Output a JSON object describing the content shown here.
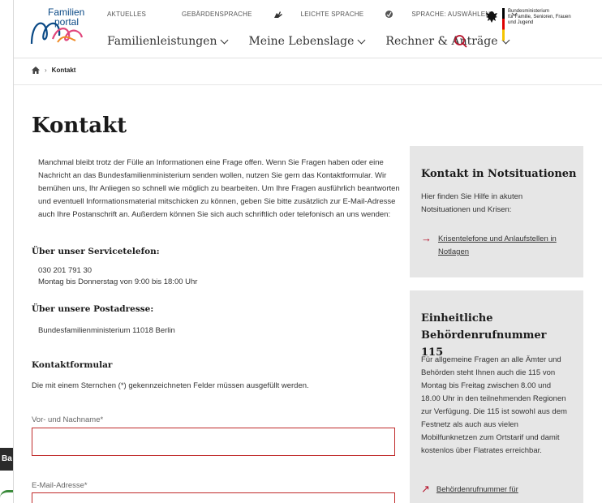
{
  "header": {
    "logo_line1": "Familien",
    "logo_line2": "portal",
    "topnav": [
      {
        "label": "AKTUELLES"
      },
      {
        "label": "GEBÄRDENSPRACHE"
      },
      {
        "label": "LEICHTE SPRACHE"
      },
      {
        "label": "SPRACHE: AUSWÄHLEN"
      }
    ],
    "mainnav": [
      {
        "label": "Familienleistungen"
      },
      {
        "label": "Meine Lebenslage"
      },
      {
        "label": "Rechner & Anträge"
      }
    ],
    "ministry": [
      "Bundesministerium",
      "für Familie, Senioren, Frauen",
      "und Jugend"
    ]
  },
  "breadcrumb": {
    "current": "Kontakt"
  },
  "page": {
    "title": "Kontakt",
    "intro": "Manchmal bleibt trotz der Fülle an Informationen eine Frage offen. Wenn Sie Fragen haben oder eine Nachricht an das Bundesfamilienministerium senden wollen, nutzen Sie gern das Kontaktformular. Wir bemühen uns, Ihr Anliegen so schnell wie möglich zu bearbeiten. Um Ihre Fragen ausführlich beantworten und eventuell Informationsmaterial mitschicken zu können, geben Sie bitte zusätzlich zur E-Mail-Adresse auch Ihre Postanschrift an. Außerdem können Sie sich auch schriftlich oder telefonisch an uns wenden:",
    "phone_heading": "Über unser Servicetelefon:",
    "phone_number": "030 201 791 30",
    "phone_hours": "Montag bis Donnerstag von 9:00 bis 18:00 Uhr",
    "post_heading": "Über unsere Postadresse:",
    "post_address": "Bundesfamilienministerium 11018 Berlin",
    "form_heading": "Kontaktformular",
    "form_note": "Die mit einem Sternchen (*) gekennzeichneten Felder müssen ausgefüllt werden.",
    "name_label": "Vor- und Nachname*",
    "email_label": "E-Mail-Adresse*"
  },
  "sidebar": {
    "box1_title": "Kontakt in Notsituationen",
    "box1_text": "Hier finden Sie Hilfe in akuten Notsituationen und Krisen:",
    "box1_link": "Krisentelefone und Anlaufstellen in Notlagen",
    "box2_title": "Einheitliche Behördenrufnummer 115",
    "box2_text": "Für allgemeine Fragen an alle Ämter und Behörden steht Ihnen auch die 115 von Montag bis Freitag zwischen 8.00 und 18.00 Uhr in den teilnehmenden Regionen zur Verfügung. Die 115 ist sowohl aus dem Festnetz als auch aus vielen Mobilfunknetzen zum Ortstarif und damit kostenlos über Flatrates erreichbar.",
    "box2_link": "Behördenrufnummer für"
  },
  "left_overlay": {
    "text": "Ba"
  },
  "colors": {
    "accent_red": "#b5122b",
    "field_border": "#c02a2a",
    "side_bg": "#e6e6e6",
    "brand_blue": "#0b4a86"
  }
}
